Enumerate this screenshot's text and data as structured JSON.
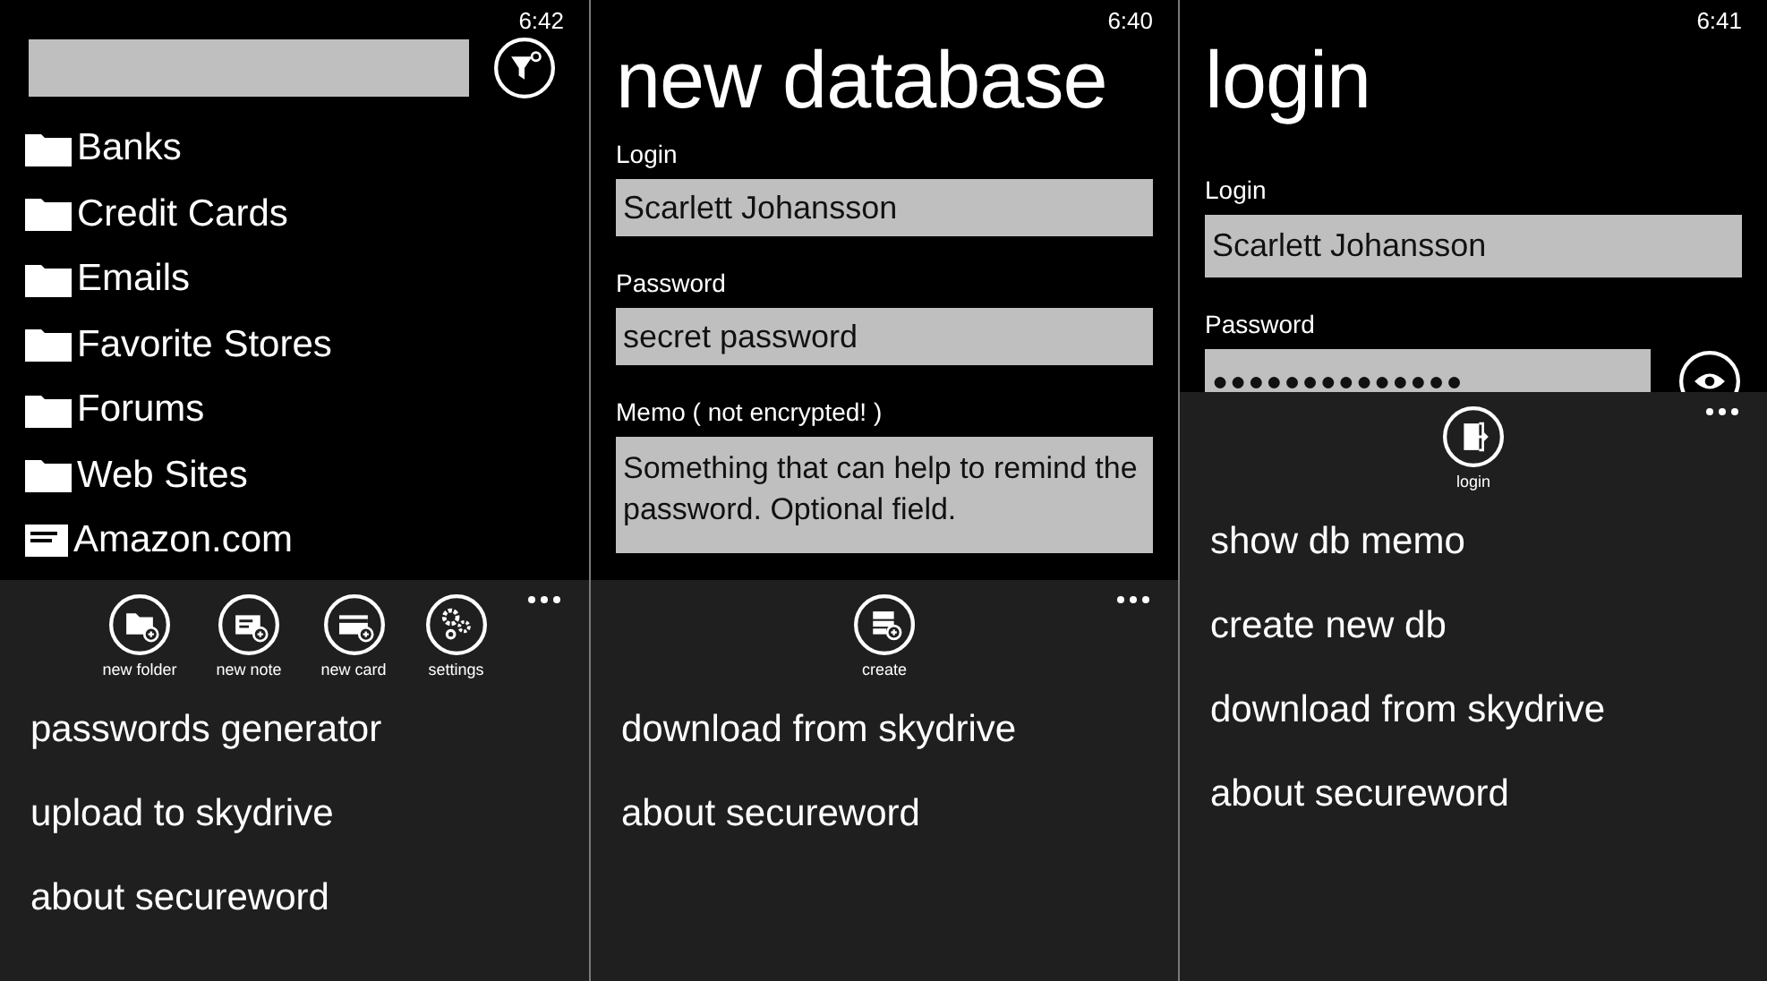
{
  "screens": [
    {
      "kind": "browser",
      "time": "6:42",
      "items": [
        {
          "kind": "folder",
          "label": "Banks"
        },
        {
          "kind": "folder",
          "label": "Credit Cards"
        },
        {
          "kind": "folder",
          "label": "Emails"
        },
        {
          "kind": "folder",
          "label": "Favorite Stores"
        },
        {
          "kind": "folder",
          "label": "Forums"
        },
        {
          "kind": "folder",
          "label": "Web Sites"
        },
        {
          "kind": "note",
          "label": "Amazon.com"
        }
      ],
      "app_bar": {
        "buttons": [
          {
            "kind": "new-folder",
            "label": "new folder"
          },
          {
            "kind": "new-note",
            "label": "new note"
          },
          {
            "kind": "new-card",
            "label": "new card"
          },
          {
            "kind": "settings",
            "label": "settings"
          }
        ],
        "menu": [
          "passwords generator",
          "upload to skydrive",
          "about secureword"
        ]
      }
    },
    {
      "kind": "form",
      "time": "6:40",
      "title": "new database",
      "fields": [
        {
          "kind": "text",
          "label": "Login",
          "value": "Scarlett Johansson"
        },
        {
          "kind": "text",
          "label": "Password",
          "value": "secret password"
        },
        {
          "kind": "memo",
          "label": "Memo ( not encrypted! )",
          "value": "Something that can help to remind the password. Optional field."
        }
      ],
      "app_bar": {
        "buttons": [
          {
            "kind": "create",
            "label": "create"
          }
        ],
        "menu": [
          "download from skydrive",
          "about secureword"
        ]
      }
    },
    {
      "kind": "login",
      "time": "6:41",
      "title": "login",
      "fields": [
        {
          "kind": "text",
          "label": "Login",
          "value": "Scarlett Johansson"
        },
        {
          "kind": "password",
          "label": "Password",
          "value": "●●●●●●●●●●●●●●"
        }
      ],
      "app_bar": {
        "buttons": [
          {
            "kind": "login",
            "label": "login"
          }
        ],
        "menu": [
          "show db memo",
          "create new db",
          "download from skydrive",
          "about secureword"
        ]
      }
    }
  ]
}
